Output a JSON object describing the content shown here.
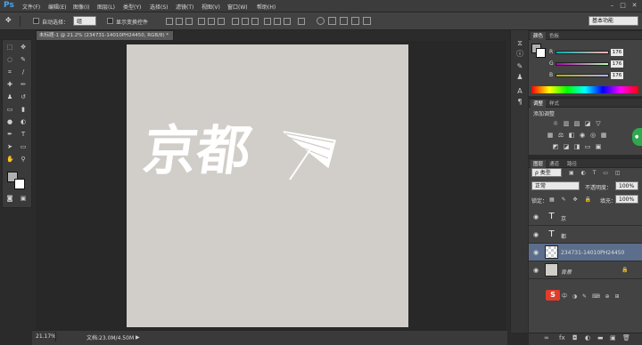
{
  "app": {
    "logo": "Ps",
    "menu": [
      "文件(F)",
      "编辑(E)",
      "图像(I)",
      "图层(L)",
      "类型(Y)",
      "选择(S)",
      "滤镜(T)",
      "视图(V)",
      "窗口(W)",
      "帮助(H)"
    ],
    "window_buttons": [
      "–",
      "□",
      "✕"
    ]
  },
  "options_bar": {
    "auto_select_label": "自动选择：",
    "auto_select_value": "组",
    "show_transform_label": "显示变换控件",
    "workspace": "基本功能"
  },
  "document": {
    "tab_title": "未标题-1 @ 21.2% (234731-14010PH24450, RGB/8) *",
    "zoom": "21.17%",
    "doc_size": "文档:23.0M/4.50M",
    "canvas_color": "#d1cdc8",
    "artwork_text": "京都"
  },
  "panels": {
    "color": {
      "tabs": [
        "颜色",
        "色板"
      ],
      "sliders": [
        {
          "label": "R",
          "value": "176"
        },
        {
          "label": "G",
          "value": "176"
        },
        {
          "label": "B",
          "value": "176"
        }
      ]
    },
    "adjustments": {
      "tabs": [
        "调整",
        "样式"
      ],
      "heading": "添加调整"
    },
    "layers": {
      "tabs": [
        "图层",
        "通道",
        "路径"
      ],
      "kind_label": "ρ 类型",
      "blend_mode": "正常",
      "opacity_label": "不透明度：",
      "opacity_value": "100%",
      "lock_label": "锁定：",
      "fill_label": "填充：",
      "fill_value": "100%",
      "items": [
        {
          "name": "京",
          "kind": "text"
        },
        {
          "name": "都",
          "kind": "text"
        },
        {
          "name": "234731-14010PH24450",
          "kind": "smart"
        },
        {
          "name": "背景",
          "kind": "background"
        }
      ]
    }
  },
  "colors": {
    "accent_selected": "#5b6e8c",
    "foreground_swatch": "#b0b0b0",
    "background_swatch": "#ffffff"
  }
}
